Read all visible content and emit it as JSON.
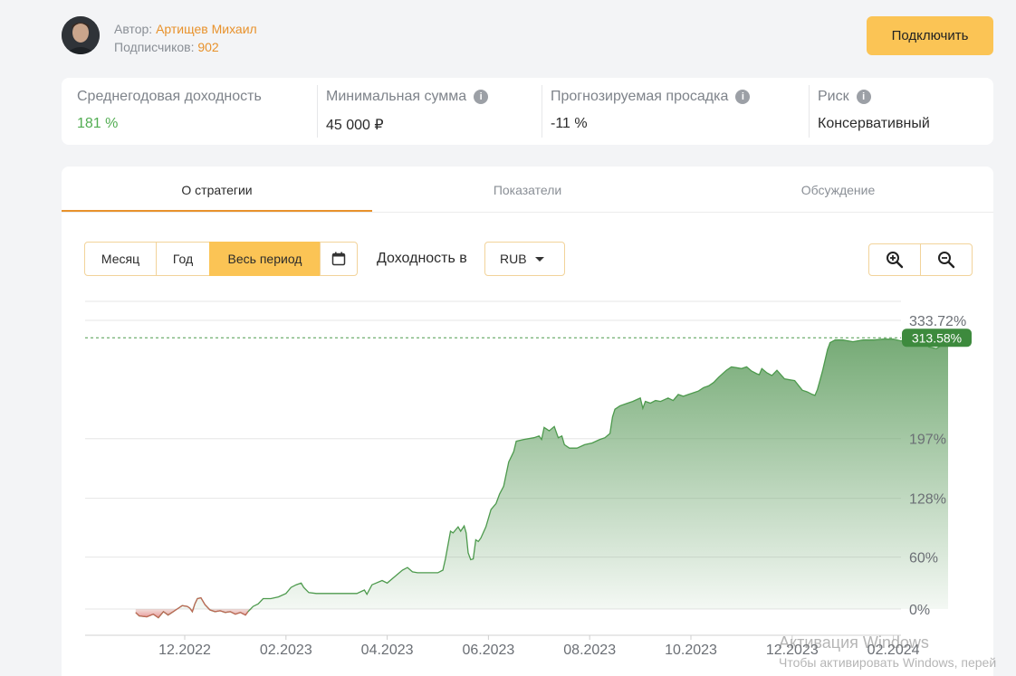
{
  "author": {
    "label": "Автор:",
    "name": "Артищев Михаил",
    "subscribers_label": "Подписчиков:",
    "subscribers": "902"
  },
  "connect_button": "Подключить",
  "stats": [
    {
      "label": "Среднегодовая доходность",
      "value": "181 %",
      "info": false
    },
    {
      "label": "Минимальная сумма",
      "value": "45 000 ₽",
      "info": true
    },
    {
      "label": "Прогнозируемая просадка",
      "value": "-11 %",
      "info": true
    },
    {
      "label": "Риск",
      "value": "Консервативный",
      "info": true
    }
  ],
  "tabs": [
    "О стратегии",
    "Показатели",
    "Обсуждение"
  ],
  "active_tab": "О стратегии",
  "period_buttons": [
    "Месяц",
    "Год",
    "Весь период"
  ],
  "active_period": "Весь период",
  "icons": {
    "calendar": "calendar-icon",
    "zoom_in": "zoom-in-icon",
    "zoom_out": "zoom-out-icon",
    "dropdown": "caret-down-icon"
  },
  "yield_label": "Доходность в",
  "currency": "RUB",
  "colors": {
    "accent": "#fbc455",
    "positive": "#52ad52",
    "line": "#4d9a4d",
    "negative": "#e05656",
    "current_badge": "#3d8a3d"
  },
  "watermark": {
    "title": "Активация Windows",
    "subtitle": "Чтобы активировать Windows, перей"
  },
  "chart_data": {
    "type": "area",
    "x_ticks": [
      "12.2022",
      "02.2023",
      "04.2023",
      "06.2023",
      "08.2023",
      "10.2023",
      "12.2023",
      "02.2024"
    ],
    "y_ticks": [
      {
        "value": 0,
        "label": "0%"
      },
      {
        "value": 60,
        "label": "60%"
      },
      {
        "value": 128,
        "label": "128%"
      },
      {
        "value": 197,
        "label": "197%"
      },
      {
        "value": 333.72,
        "label": "333.72%"
      }
    ],
    "current": {
      "value": 313.58,
      "label": "313.58%"
    },
    "x_range": [
      -0.97,
      15.2
    ],
    "ylim": [
      -30,
      360
    ],
    "grid": true,
    "x_unit": "months since 12.2022",
    "series": [
      {
        "values": [
          [
            -0.97,
            -4
          ],
          [
            -0.9,
            -8
          ],
          [
            -0.75,
            -9
          ],
          [
            -0.62,
            -6
          ],
          [
            -0.52,
            -10
          ],
          [
            -0.42,
            -3
          ],
          [
            -0.33,
            -7
          ],
          [
            -0.25,
            -4
          ],
          [
            -0.15,
            0
          ],
          [
            -0.05,
            4
          ],
          [
            0.05,
            3
          ],
          [
            0.1,
            1
          ],
          [
            0.15,
            -3
          ],
          [
            0.2,
            6
          ],
          [
            0.25,
            12
          ],
          [
            0.32,
            13
          ],
          [
            0.4,
            5
          ],
          [
            0.5,
            -1
          ],
          [
            0.6,
            -3
          ],
          [
            0.7,
            -2
          ],
          [
            0.8,
            -4
          ],
          [
            0.9,
            -3
          ],
          [
            1.0,
            -6
          ],
          [
            1.1,
            -4
          ],
          [
            1.2,
            -7
          ],
          [
            1.25,
            -3
          ],
          [
            1.35,
            3
          ],
          [
            1.45,
            6
          ],
          [
            1.55,
            12
          ],
          [
            1.7,
            12
          ],
          [
            1.85,
            14
          ],
          [
            2.0,
            18
          ],
          [
            2.1,
            25
          ],
          [
            2.2,
            28
          ],
          [
            2.3,
            30
          ],
          [
            2.35,
            25
          ],
          [
            2.45,
            19
          ],
          [
            2.6,
            18
          ],
          [
            2.8,
            18
          ],
          [
            3.0,
            18
          ],
          [
            3.2,
            18
          ],
          [
            3.4,
            18
          ],
          [
            3.55,
            22
          ],
          [
            3.6,
            17
          ],
          [
            3.7,
            28
          ],
          [
            3.9,
            33
          ],
          [
            4.0,
            30
          ],
          [
            4.1,
            35
          ],
          [
            4.2,
            40
          ],
          [
            4.3,
            45
          ],
          [
            4.4,
            48
          ],
          [
            4.5,
            43
          ],
          [
            4.6,
            42
          ],
          [
            4.8,
            42
          ],
          [
            5.0,
            42
          ],
          [
            5.1,
            45
          ],
          [
            5.15,
            58
          ],
          [
            5.25,
            90
          ],
          [
            5.3,
            88
          ],
          [
            5.4,
            95
          ],
          [
            5.45,
            90
          ],
          [
            5.52,
            96
          ],
          [
            5.56,
            88
          ],
          [
            5.6,
            65
          ],
          [
            5.65,
            57
          ],
          [
            5.7,
            58
          ],
          [
            5.75,
            80
          ],
          [
            5.8,
            78
          ],
          [
            5.85,
            82
          ],
          [
            5.95,
            95
          ],
          [
            6.05,
            115
          ],
          [
            6.15,
            122
          ],
          [
            6.22,
            133
          ],
          [
            6.3,
            142
          ],
          [
            6.4,
            170
          ],
          [
            6.5,
            182
          ],
          [
            6.55,
            194
          ],
          [
            6.7,
            196
          ],
          [
            6.9,
            198
          ],
          [
            7.0,
            200
          ],
          [
            7.05,
            196
          ],
          [
            7.1,
            210
          ],
          [
            7.2,
            206
          ],
          [
            7.3,
            211
          ],
          [
            7.38,
            198
          ],
          [
            7.45,
            200
          ],
          [
            7.5,
            190
          ],
          [
            7.6,
            186
          ],
          [
            7.75,
            186
          ],
          [
            7.9,
            190
          ],
          [
            8.05,
            192
          ],
          [
            8.2,
            196
          ],
          [
            8.3,
            198
          ],
          [
            8.4,
            203
          ],
          [
            8.45,
            222
          ],
          [
            8.5,
            231
          ],
          [
            8.6,
            235
          ],
          [
            8.75,
            238
          ],
          [
            8.85,
            240
          ],
          [
            9.0,
            244
          ],
          [
            9.05,
            232
          ],
          [
            9.1,
            240
          ],
          [
            9.2,
            238
          ],
          [
            9.3,
            241
          ],
          [
            9.4,
            240
          ],
          [
            9.55,
            244
          ],
          [
            9.65,
            241
          ],
          [
            9.75,
            248
          ],
          [
            9.85,
            246
          ],
          [
            9.95,
            248
          ],
          [
            10.05,
            250
          ],
          [
            10.15,
            252
          ],
          [
            10.25,
            256
          ],
          [
            10.35,
            258
          ],
          [
            10.45,
            262
          ],
          [
            10.55,
            268
          ],
          [
            10.7,
            276
          ],
          [
            10.8,
            280
          ],
          [
            10.9,
            279
          ],
          [
            11.0,
            278
          ],
          [
            11.1,
            280
          ],
          [
            11.2,
            275
          ],
          [
            11.3,
            272
          ],
          [
            11.35,
            271
          ],
          [
            11.4,
            278
          ],
          [
            11.5,
            273
          ],
          [
            11.6,
            270
          ],
          [
            11.7,
            276
          ],
          [
            11.85,
            266
          ],
          [
            11.95,
            265
          ],
          [
            12.05,
            264
          ],
          [
            12.2,
            253
          ],
          [
            12.3,
            251
          ],
          [
            12.4,
            248
          ],
          [
            12.45,
            247
          ],
          [
            12.5,
            254
          ],
          [
            12.6,
            275
          ],
          [
            12.7,
            300
          ],
          [
            12.75,
            308
          ],
          [
            12.85,
            311
          ],
          [
            13.0,
            311
          ],
          [
            13.2,
            309
          ],
          [
            13.4,
            311
          ],
          [
            13.6,
            311
          ],
          [
            13.8,
            312
          ],
          [
            14.0,
            312
          ],
          [
            14.15,
            310
          ],
          [
            14.35,
            313
          ],
          [
            14.45,
            312
          ],
          [
            14.55,
            314
          ],
          [
            14.7,
            303
          ],
          [
            14.85,
            301
          ],
          [
            14.95,
            305
          ],
          [
            15.04,
            310
          ],
          [
            15.08,
            313.58
          ]
        ]
      }
    ]
  }
}
